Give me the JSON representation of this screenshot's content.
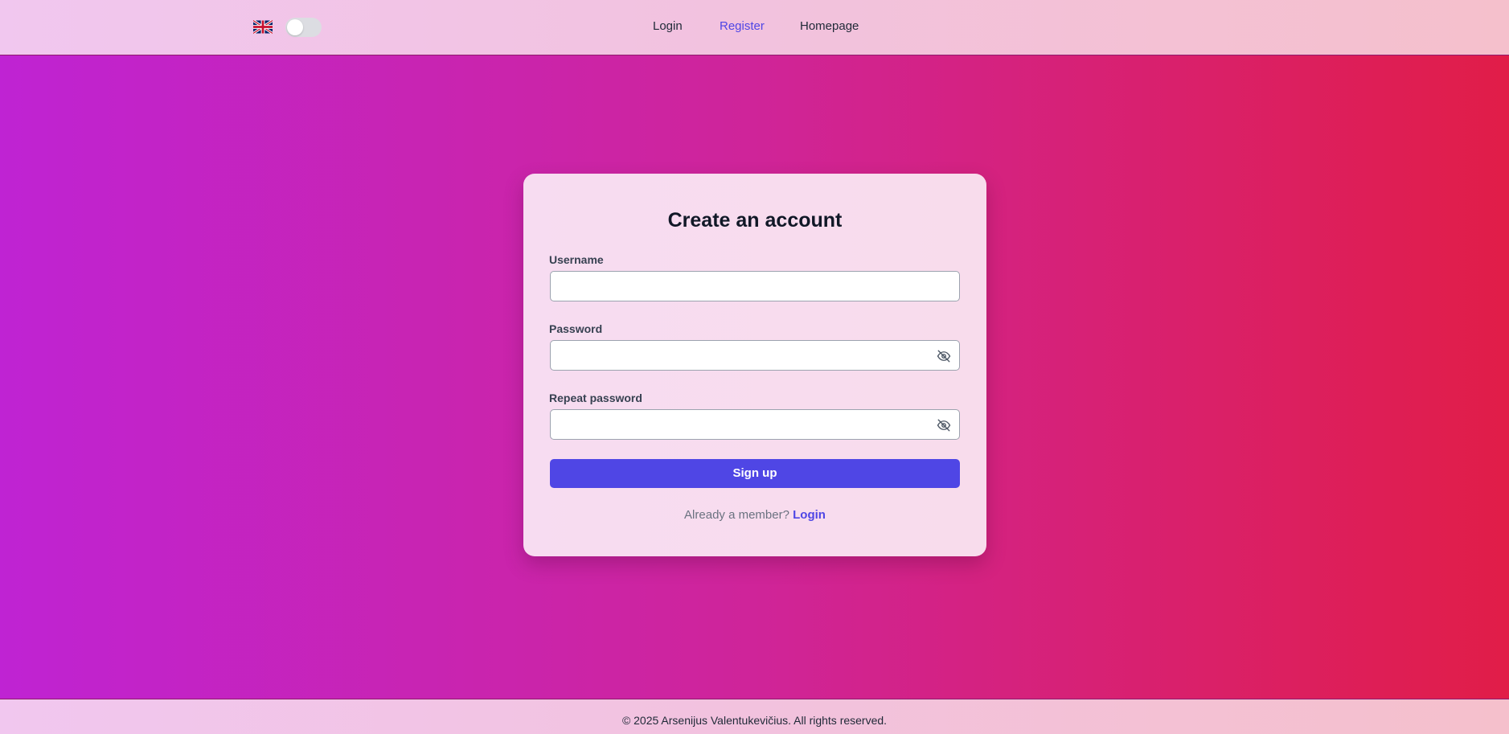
{
  "header": {
    "language_icon": "uk-flag-icon",
    "theme_toggle": {
      "state": "off"
    },
    "nav": {
      "login": "Login",
      "register": "Register",
      "homepage": "Homepage"
    },
    "active_nav": "register"
  },
  "form": {
    "title": "Create an account",
    "username": {
      "label": "Username",
      "value": "",
      "placeholder": ""
    },
    "password": {
      "label": "Password",
      "value": "",
      "placeholder": "",
      "icon": "eye-off-icon"
    },
    "repeat_password": {
      "label": "Repeat password",
      "value": "",
      "placeholder": "",
      "icon": "eye-off-icon"
    },
    "submit_label": "Sign up",
    "member_text": "Already a member?",
    "member_link": "Login"
  },
  "footer": {
    "text": "© 2025 Arsenijus Valentukevičius. All rights reserved."
  },
  "colors": {
    "accent": "#4f46e5",
    "gradient_start": "#bf23d3",
    "gradient_end": "#e11d48"
  }
}
